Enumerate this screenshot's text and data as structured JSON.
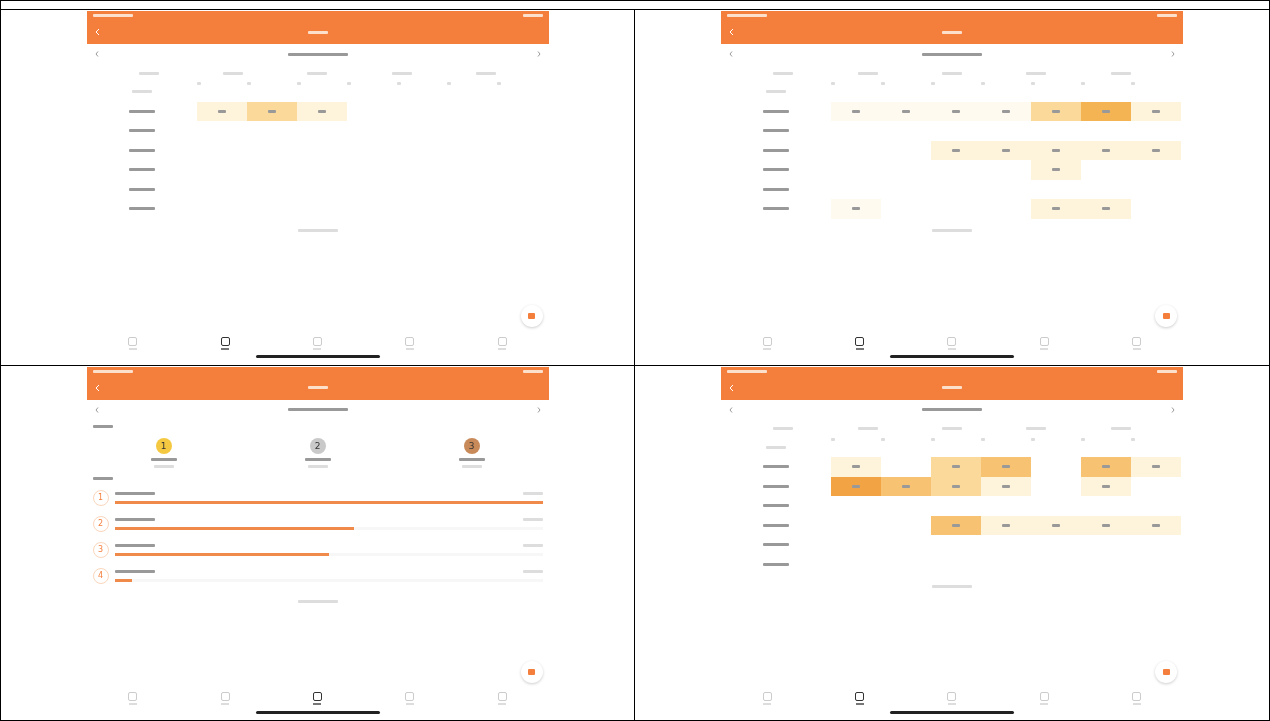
{
  "panels": [
    {
      "kind": "timetable",
      "tabs": [
        {
          "selected": false
        },
        {
          "selected": true
        },
        {
          "selected": false
        },
        {
          "selected": false
        },
        {
          "selected": false
        }
      ],
      "rows": [
        {
          "cells": [
            {
              "color": "#fef4dc"
            },
            {
              "color": "#fbd99a"
            },
            {
              "color": "#fef4dc"
            },
            null,
            null,
            null,
            null
          ]
        },
        {
          "cells": [
            null,
            null,
            null,
            null,
            null,
            null,
            null
          ]
        },
        {
          "cells": [
            null,
            null,
            null,
            null,
            null,
            null,
            null
          ]
        },
        {
          "cells": [
            null,
            null,
            null,
            null,
            null,
            null,
            null
          ]
        },
        {
          "cells": [
            null,
            null,
            null,
            null,
            null,
            null,
            null
          ]
        },
        {
          "cells": [
            null,
            null,
            null,
            null,
            null,
            null,
            null
          ]
        }
      ]
    },
    {
      "kind": "timetable",
      "tabs": [
        {
          "selected": false
        },
        {
          "selected": true
        },
        {
          "selected": false
        },
        {
          "selected": false
        },
        {
          "selected": false
        }
      ],
      "rows": [
        {
          "cells": [
            {
              "color": "#fffaf0"
            },
            {
              "color": "#fffaf0"
            },
            {
              "color": "#fffaf0"
            },
            {
              "color": "#fffaf0"
            },
            {
              "color": "#fbd99a"
            },
            {
              "color": "#f5b454"
            },
            {
              "color": "#fef4dc"
            }
          ]
        },
        {
          "cells": [
            null,
            null,
            null,
            null,
            null,
            null,
            null
          ]
        },
        {
          "cells": [
            null,
            null,
            {
              "color": "#fef4dc"
            },
            {
              "color": "#fef4dc"
            },
            {
              "color": "#fef4dc"
            },
            {
              "color": "#fef4dc"
            },
            {
              "color": "#fef4dc"
            }
          ]
        },
        {
          "cells": [
            null,
            null,
            null,
            null,
            {
              "color": "#fef4dc"
            },
            null,
            null
          ]
        },
        {
          "cells": [
            null,
            null,
            null,
            null,
            null,
            null,
            null
          ]
        },
        {
          "cells": [
            {
              "color": "#fffaf0"
            },
            null,
            null,
            null,
            {
              "color": "#fef4dc"
            },
            {
              "color": "#fef4dc"
            },
            null
          ]
        }
      ]
    },
    {
      "kind": "ranking",
      "tabs": [
        {
          "selected": false
        },
        {
          "selected": false
        },
        {
          "selected": true
        },
        {
          "selected": false
        },
        {
          "selected": false
        }
      ],
      "medals": [
        {
          "rank": "1",
          "color": "#f5c842"
        },
        {
          "rank": "2",
          "color": "#c9c9c9"
        },
        {
          "rank": "3",
          "color": "#c98a5a"
        }
      ],
      "ranks": [
        {
          "rank": "1",
          "level": 1.0
        },
        {
          "rank": "2",
          "level": 0.56
        },
        {
          "rank": "3",
          "level": 0.5
        },
        {
          "rank": "4",
          "level": 0.04
        }
      ]
    },
    {
      "kind": "timetable",
      "tabs": [
        {
          "selected": false
        },
        {
          "selected": true
        },
        {
          "selected": false
        },
        {
          "selected": false
        },
        {
          "selected": false
        }
      ],
      "rows": [
        {
          "cells": [
            {
              "color": "#fef4dc"
            },
            null,
            {
              "color": "#fbd99a"
            },
            {
              "color": "#f7c373"
            },
            null,
            {
              "color": "#f7c373"
            },
            {
              "color": "#fef4dc"
            }
          ]
        },
        {
          "cells": [
            {
              "color": "#f2a444"
            },
            {
              "color": "#f7c373"
            },
            {
              "color": "#fbd99a"
            },
            {
              "color": "#fef4dc"
            },
            null,
            {
              "color": "#fef4dc"
            },
            null
          ]
        },
        {
          "cells": [
            null,
            null,
            null,
            null,
            null,
            null,
            null
          ]
        },
        {
          "cells": [
            null,
            null,
            {
              "color": "#f7c373"
            },
            {
              "color": "#fef4dc"
            },
            {
              "color": "#fef4dc"
            },
            {
              "color": "#fef4dc"
            },
            {
              "color": "#fef4dc"
            }
          ]
        },
        {
          "cells": [
            null,
            null,
            null,
            null,
            null,
            null,
            null
          ]
        },
        {
          "cells": [
            null,
            null,
            null,
            null,
            null,
            null,
            null
          ]
        }
      ]
    }
  ]
}
